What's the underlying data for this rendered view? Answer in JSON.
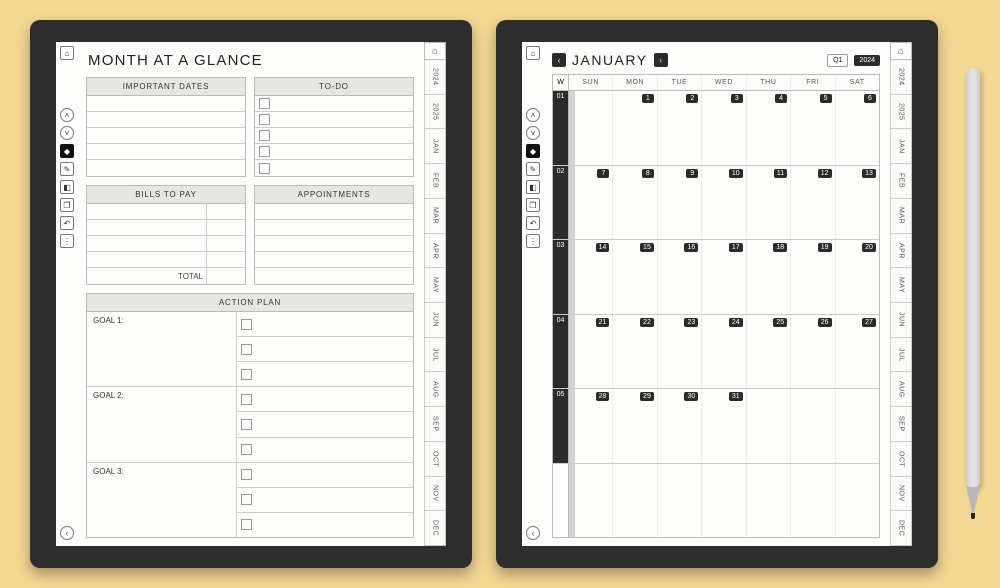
{
  "page1": {
    "title": "MONTH AT A GLANCE",
    "sections": {
      "important_dates": "IMPORTANT DATES",
      "todo": "TO-DO",
      "bills": "BILLS TO PAY",
      "bills_total": "TOTAL",
      "appointments": "APPOINTMENTS",
      "action_plan": "ACTION PLAN",
      "goal1": "GOAL 1:",
      "goal2": "GOAL 2:",
      "goal3": "GOAL 3:"
    }
  },
  "page2": {
    "month": "JANUARY",
    "quarter": "Q1",
    "year": "2024",
    "day_headers": [
      "SUN",
      "MON",
      "TUE",
      "WED",
      "THU",
      "FRI",
      "SAT"
    ],
    "weekno_label": "W",
    "weeks": [
      {
        "no": "01",
        "days": [
          "",
          "1",
          "2",
          "3",
          "4",
          "5",
          "6"
        ]
      },
      {
        "no": "02",
        "days": [
          "7",
          "8",
          "9",
          "10",
          "11",
          "12",
          "13"
        ]
      },
      {
        "no": "03",
        "days": [
          "14",
          "15",
          "16",
          "17",
          "18",
          "19",
          "20"
        ]
      },
      {
        "no": "04",
        "days": [
          "21",
          "22",
          "23",
          "24",
          "25",
          "26",
          "27"
        ]
      },
      {
        "no": "05",
        "days": [
          "28",
          "29",
          "30",
          "31",
          "",
          "",
          ""
        ]
      },
      {
        "no": "",
        "days": [
          "",
          "",
          "",
          "",
          "",
          "",
          ""
        ]
      }
    ]
  },
  "sidetabs": [
    "2024",
    "2025",
    "JAN",
    "FEB",
    "MAR",
    "APR",
    "MAY",
    "JUN",
    "JUL",
    "AUG",
    "SEP",
    "OCT",
    "NOV",
    "DEC"
  ],
  "toolbar_icons": {
    "home": "⌂",
    "up": "˄",
    "down": "˅",
    "left": "‹",
    "right": "›",
    "highlight": "◆",
    "pen": "✎",
    "erase": "◧",
    "note": "❐",
    "undo": "↶",
    "more": "⋮"
  }
}
